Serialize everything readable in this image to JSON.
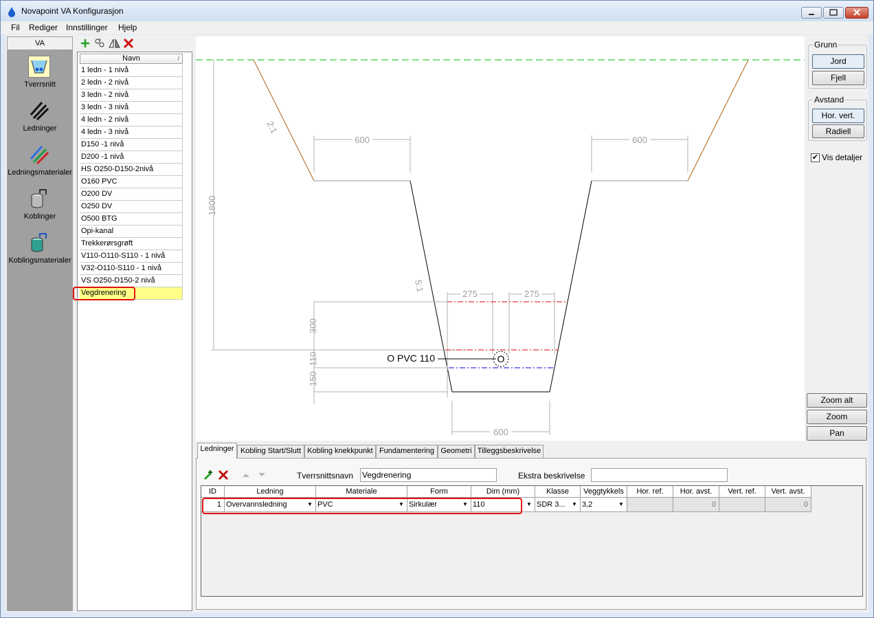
{
  "window": {
    "title": "Novapoint VA Konfigurasjon"
  },
  "menu": [
    "Fil",
    "Rediger",
    "Innstillinger",
    "Hjelp"
  ],
  "sidebar": {
    "header": "VA",
    "items": [
      {
        "label": "Tverrsnitt",
        "icon": "trench-cross-section-icon"
      },
      {
        "label": "Ledninger",
        "icon": "pipes-icon"
      },
      {
        "label": "Ledningsmaterialer",
        "icon": "pipe-materials-icon"
      },
      {
        "label": "Koblinger",
        "icon": "couplings-icon"
      },
      {
        "label": "Koblingsmaterialer",
        "icon": "coupling-materials-icon"
      }
    ]
  },
  "list": {
    "header": "Navn",
    "sort_indicator": "/",
    "items": [
      "1 ledn - 1 nivå",
      "2 ledn - 2 nivå",
      "3 ledn - 2 nivå",
      "3 ledn - 3 nivå",
      "4 ledn - 2 nivå",
      "4 ledn - 3 nivå",
      "D150 -1 nivå",
      "D200 -1 nivå",
      "HS O250-D150-2nivå",
      "O160 PVC",
      "O200 DV",
      "O250 DV",
      "O500 BTG",
      "Opi-kanal",
      "Trekkerørsgrøft",
      "V110-O110-S110 - 1 nivå",
      "V32-O110-S110 - 1 nivå",
      "VS O250-D150-2 nivå",
      "Vegdrenering"
    ],
    "selected": "Vegdrenering"
  },
  "drawing": {
    "dims": {
      "width_top_left": "600",
      "width_top_right": "600",
      "depth": "1800",
      "slope_upper": "2:1",
      "slope_lower": "5:1",
      "offset_left": "275",
      "offset_right": "275",
      "depth_300": "300",
      "depth_150": "150",
      "pipe_dim": "110",
      "bottom_width": "600"
    },
    "pipe_label": "O PVC 110",
    "pipe_symbol": "O",
    "colors": {
      "ground_line": "#00c000",
      "slope": "#b06010",
      "red_line": "#e00000",
      "blue_line": "#0000e0",
      "dim_text": "#a0a0a0"
    }
  },
  "right_panel": {
    "grunn_label": "Grunn",
    "jord": "Jord",
    "fjell": "Fjell",
    "avstand_label": "Avstand",
    "hor_vert": "Hor. vert.",
    "radiell": "Radiell",
    "vis_detaljer": "Vis detaljer",
    "vis_detaljer_checked": "✔",
    "zoom_alt": "Zoom alt",
    "zoom": "Zoom",
    "pan": "Pan"
  },
  "tabs": [
    "Ledninger",
    "Kobling Start/Slutt",
    "Kobling knekkpunkt",
    "Fundamentering",
    "Geometri",
    "Tilleggsbeskrivelse"
  ],
  "form": {
    "tverrsnittsnavn_label": "Tverrsnittsnavn",
    "tverrsnittsnavn_value": "Vegdrenering",
    "ekstra_label": "Ekstra beskrivelse",
    "ekstra_value": ""
  },
  "grid": {
    "columns": [
      "ID",
      "Ledning",
      "Materiale",
      "Form",
      "Dim (mm)",
      "Klasse",
      "Veggtykkels",
      "Hor. ref.",
      "Hor. avst.",
      "Vert. ref.",
      "Vert. avst."
    ],
    "row": {
      "id": "1",
      "ledning": "Overvannsledning",
      "materiale": "PVC",
      "form": "Sirkulær",
      "dim": "110",
      "klasse": "SDR 3...",
      "vegg": "3,2",
      "hor_ref": "",
      "hor_avst": "0",
      "vert_ref": "",
      "vert_avst": "0"
    }
  }
}
